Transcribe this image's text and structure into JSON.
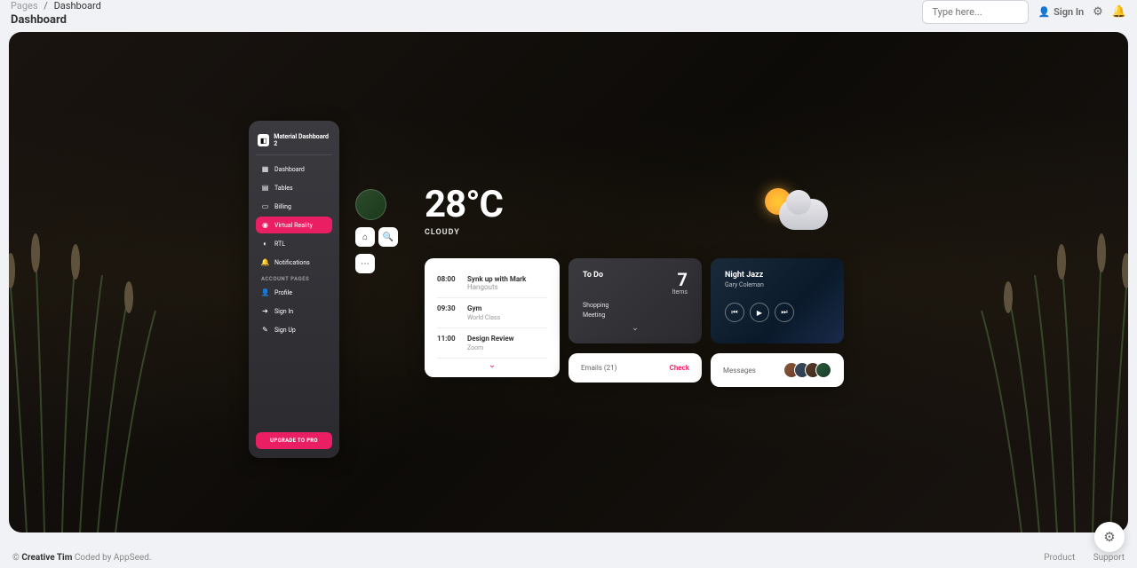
{
  "breadcrumb": {
    "root": "Pages",
    "current": "Dashboard"
  },
  "page_title": "Dashboard",
  "search": {
    "placeholder": "Type here..."
  },
  "signin_label": "Sign In",
  "sidebar": {
    "brand": "Material Dashboard 2",
    "items": [
      {
        "label": "Dashboard",
        "active": false
      },
      {
        "label": "Tables",
        "active": false
      },
      {
        "label": "Billing",
        "active": false
      },
      {
        "label": "Virtual Reality",
        "active": true
      },
      {
        "label": "RTL",
        "active": false
      },
      {
        "label": "Notifications",
        "active": false
      }
    ],
    "section_label": "ACCOUNT PAGES",
    "account_items": [
      {
        "label": "Profile"
      },
      {
        "label": "Sign In"
      },
      {
        "label": "Sign Up"
      }
    ],
    "upgrade": "UPGRADE TO PRO"
  },
  "weather": {
    "temp": "28°C",
    "desc": "CLOUDY"
  },
  "schedule": [
    {
      "time": "08:00",
      "title": "Synk up with Mark",
      "suffix": "Hangouts",
      "sub": ""
    },
    {
      "time": "09:30",
      "title": "Gym",
      "suffix": "",
      "sub": "World Class"
    },
    {
      "time": "11:00",
      "title": "Design Review",
      "suffix": "",
      "sub": "Zoom"
    }
  ],
  "todo": {
    "title": "To Do",
    "count": "7",
    "items_label": "Items",
    "list": [
      "Shopping",
      "Meeting"
    ]
  },
  "emails": {
    "label": "Emails (21)",
    "action": "Check"
  },
  "music": {
    "title": "Night Jazz",
    "artist": "Gary Coleman"
  },
  "messages": {
    "label": "Messages"
  },
  "footer": {
    "copy_prefix": "© ",
    "brand": "Creative Tim",
    "suffix": " Coded by AppSeed.",
    "links": [
      "Product",
      "Support"
    ]
  }
}
